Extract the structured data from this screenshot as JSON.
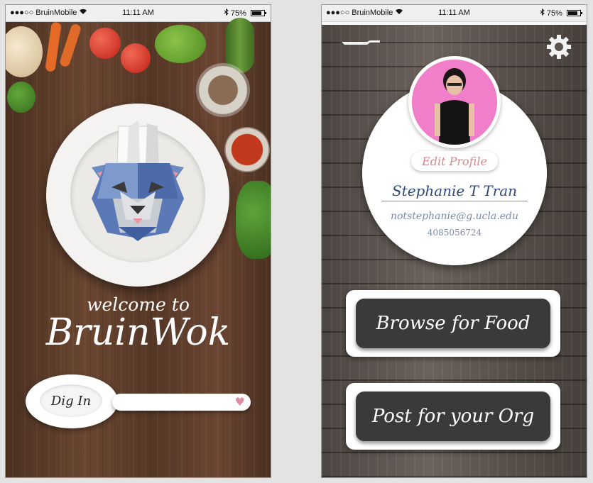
{
  "status_bar": {
    "signal": "●●●○○",
    "carrier": "BruinMobile",
    "wifi_icon": "wifi-icon",
    "time": "11:11 AM",
    "bluetooth_icon": "bluetooth-icon",
    "battery_percent": "75%",
    "battery_level": 0.75
  },
  "welcome_screen": {
    "welcome_line": "welcome to",
    "app_name": "BruinWok",
    "dig_in_label": "Dig In",
    "heart_icon": "heart-icon",
    "logo_icon": "chef-bear-logo"
  },
  "profile_screen": {
    "menu_icon": "knife-menu-icon",
    "settings_icon": "gear-icon",
    "edit_profile_label": "Edit Profile",
    "name": "Stephanie T Tran",
    "email": "notstephanie@g.ucla.edu",
    "phone": "4085056724",
    "browse_label": "Browse for Food",
    "post_label": "Post for your Org"
  },
  "colors": {
    "edit_profile_text": "#cf8a90",
    "name_text": "#2e4a7a",
    "button_bg": "#3a3a3a",
    "avatar_bg": "#f07ec8"
  }
}
